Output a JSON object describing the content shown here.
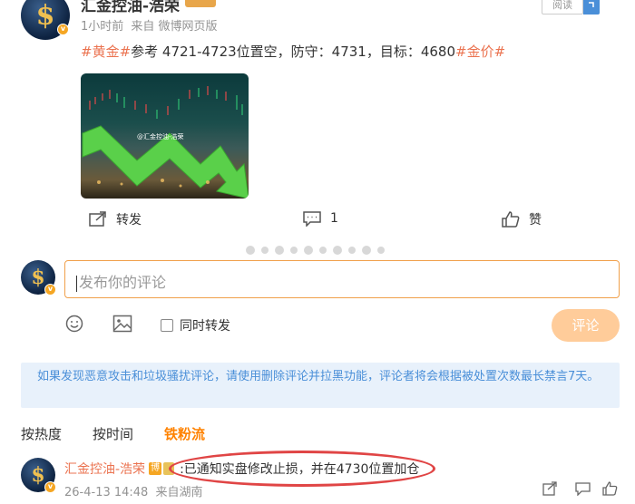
{
  "post": {
    "author": "汇金控油-浩荣",
    "time": "1小时前",
    "source": "来自 微博网页版",
    "read_label": "阅读",
    "hashtag1": "#黄金#",
    "body": "参考 4721-4723位置空，防守：4731，目标：4680",
    "hashtag2": "#金价#",
    "image_watermark": "@汇金控油-浩荣",
    "actions": {
      "repost": "转发",
      "comment_count": "1",
      "like": "赞"
    }
  },
  "composer": {
    "placeholder": "发布你的评论",
    "also_repost": "同时转发",
    "submit": "评论"
  },
  "notice": "如果发现恶意攻击和垃圾骚扰评论，请使用删除评论并拉黑功能，评论者将会根据被处置次数最长禁言7天。",
  "tabs": [
    "按热度",
    "按时间",
    "铁粉流"
  ],
  "comment": {
    "author": "汇金控油-浩荣",
    "badge": "博",
    "text": ":已通知实盘修改止损，并在4730位置加仓",
    "time": "26-4-13 14:48",
    "location": "来自湖南"
  },
  "colors": {
    "accent": "#ff8200",
    "hashtag": "#eb7350",
    "notice_bg": "#e8f1fb",
    "highlight_ellipse": "#e04545"
  }
}
